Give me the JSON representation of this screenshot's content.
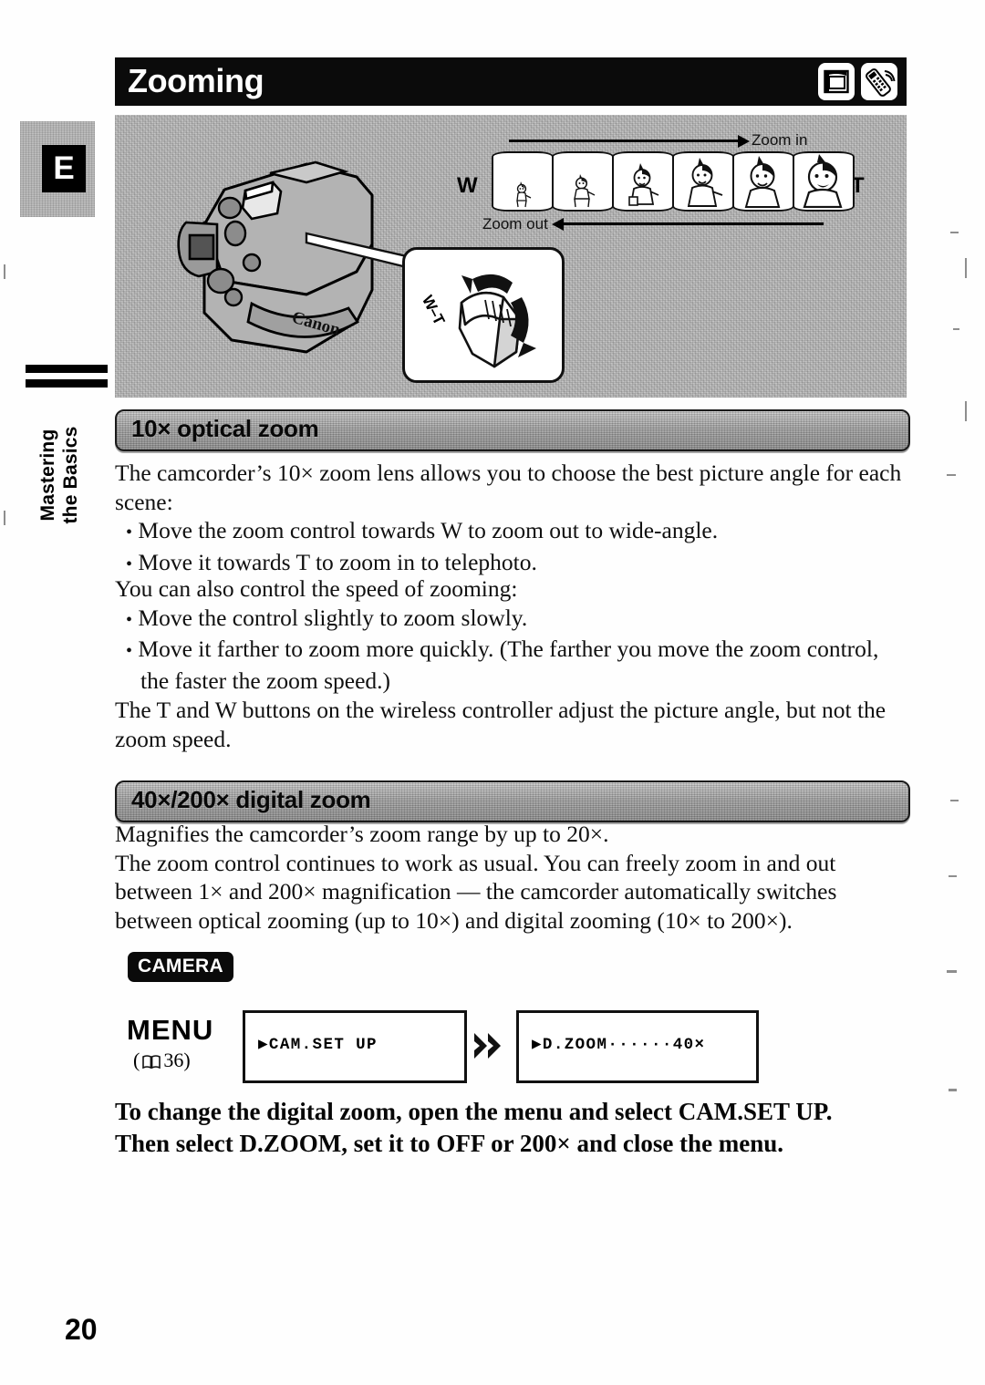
{
  "page": {
    "number": "20",
    "section_tab_letter": "E",
    "side_label_line1": "Mastering",
    "side_label_line2": "the Basics"
  },
  "header": {
    "title": "Zooming",
    "icons": [
      {
        "name": "tape-card-icon"
      },
      {
        "name": "wireless-remote-icon"
      }
    ]
  },
  "figure": {
    "zoom_in_label": "Zoom in",
    "zoom_out_label": "Zoom out",
    "wide_label": "W",
    "tele_label": "T",
    "rocker_label": "W–T",
    "brand": "Canon",
    "frame_count": 6
  },
  "sections": [
    {
      "heading": "10× optical zoom",
      "paragraphs": [
        "The camcorder’s 10× zoom lens allows you to choose the best picture angle for each scene:"
      ],
      "bullets": [
        "Move the zoom control towards W to zoom out to wide-angle.",
        "Move it towards T to zoom in to telephoto."
      ]
    },
    {
      "heading": "40×/200× digital zoom"
    }
  ],
  "speed_block": {
    "intro": "You can also control the speed of zooming:",
    "bullets": [
      "Move the control slightly to zoom slowly.",
      "Move it farther to zoom more quickly. (The farther you move the zoom control, the faster the zoom speed.)"
    ]
  },
  "wireless_note": "The T and W buttons on the wireless controller adjust the picture angle, but not the zoom speed.",
  "digital_zoom_text": {
    "line1": "Magnifies the camcorder’s zoom range by up to 20×.",
    "line2": "The zoom control continues to work as usual. You can freely zoom in and out between 1× and 200× magnification — the camcorder automatically switches between optical zooming (up to 10×) and digital zooming (10× to 200×)."
  },
  "mode_badge": "CAMERA",
  "menu_flow": {
    "label": "MENU",
    "reference_prefix": "(",
    "reference_page": "36",
    "reference_suffix": ")",
    "step1": "▶CAM.SET UP",
    "step2": "▶D.ZOOM······40×"
  },
  "instruction": {
    "line1": "To change the digital zoom, open the menu and select CAM.SET UP.",
    "line2": "Then select D.ZOOM, set it to OFF or 200× and close the menu."
  },
  "colors": {
    "title_bar": "#0b0b0b",
    "section_bar": "#a4a4a4",
    "badge": "#0a0a0a",
    "paper": "#ffffff"
  }
}
